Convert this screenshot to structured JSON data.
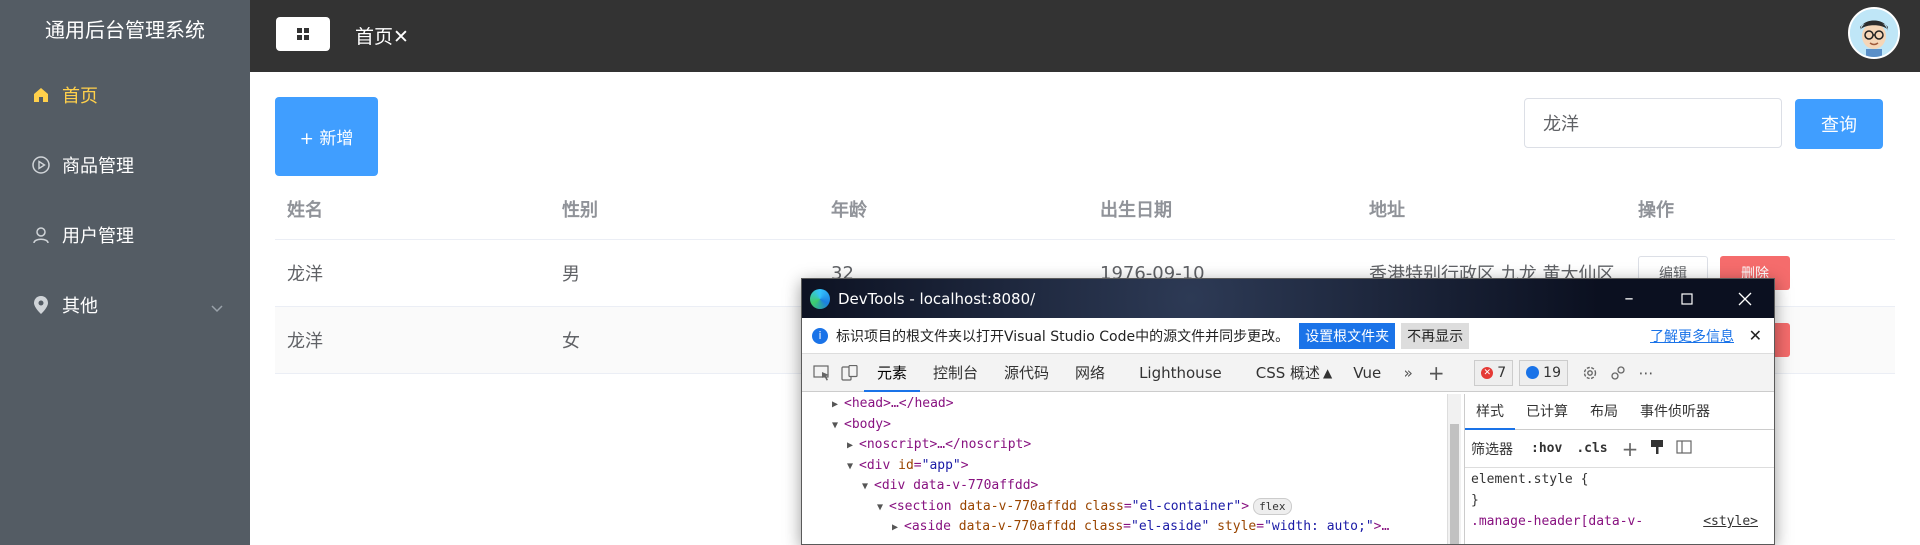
{
  "app": {
    "title": "通用后台管理系统"
  },
  "sidebar": {
    "items": [
      {
        "label": "首页",
        "icon": "home-icon",
        "active": true
      },
      {
        "label": "商品管理",
        "icon": "video-play-icon"
      },
      {
        "label": "用户管理",
        "icon": "user-icon"
      },
      {
        "label": "其他",
        "icon": "location-icon"
      }
    ]
  },
  "header": {
    "breadcrumb": "首页✕"
  },
  "toolbar": {
    "add_label": "+ 新增",
    "search_value": "龙洋",
    "query_label": "查询"
  },
  "table": {
    "columns": [
      "姓名",
      "性别",
      "年龄",
      "出生日期",
      "地址",
      "操作"
    ],
    "rows": [
      {
        "name": "龙洋",
        "sex": "男",
        "age": "32",
        "birth": "1976-09-10",
        "addr": "香港特别行政区 九龙 黄大仙区"
      },
      {
        "name": "龙洋",
        "sex": "女"
      }
    ],
    "edit_label": "编辑",
    "delete_label": "删除"
  },
  "devtools": {
    "title": "DevTools - localhost:8080/",
    "info_text": "标识项目的根文件夹以打开Visual Studio Code中的源文件并同步更改。",
    "set_root_label": "设置根文件夹",
    "dont_show_label": "不再显示",
    "learn_more_label": "了解更多信息",
    "tabs": [
      "元素",
      "控制台",
      "源代码",
      "网络",
      "Lighthouse",
      "CSS 概述",
      "Vue"
    ],
    "error_count": "7",
    "message_count": "19",
    "style_tabs": [
      "样式",
      "已计算",
      "布局",
      "事件侦听器"
    ],
    "filter_label": "筛选器",
    "hov_label": ":hov",
    "cls_label": ".cls",
    "element_style": "element.style {",
    "close_brace": "}",
    "rule_selector": ".manage-header[data-v-",
    "rule_source": "<style>",
    "dom_lines": {
      "head": "<head>…</head>",
      "body": "<body>",
      "noscript": "<noscript>…</noscript>",
      "div_app_tag": "<div",
      "div_app_attr": "id",
      "div_app_val": "\"app\"",
      "div_app_close": ">",
      "div_v": "<div data-v-770affdd>",
      "section_tag": "<section",
      "section_attr1": "data-v-770affdd",
      "section_attr2": "class",
      "section_val": "\"el-container\"",
      "section_close": ">",
      "flex_badge": "flex",
      "aside_tag": "<aside",
      "aside_attr1": "data-v-770affdd",
      "aside_attr2": "class",
      "aside_val": "\"el-aside\"",
      "aside_attr3": "style",
      "aside_val2": "\"width: auto;\"",
      "aside_close": ">…"
    }
  }
}
